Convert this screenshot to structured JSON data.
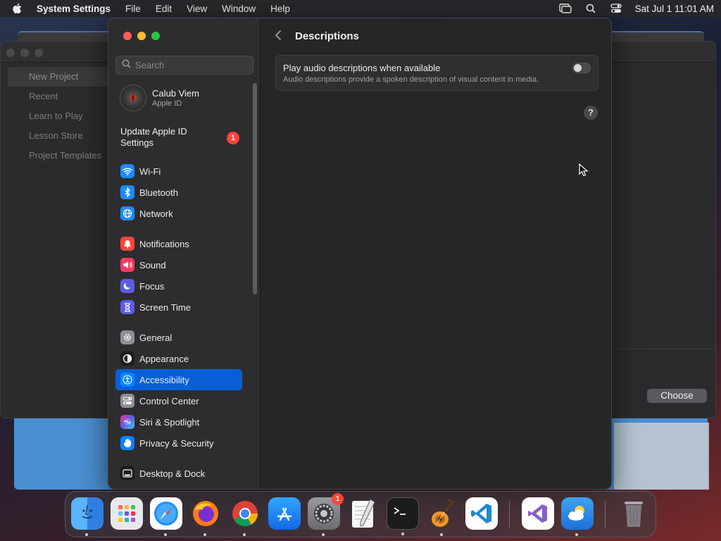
{
  "menubar": {
    "app_name": "System Settings",
    "menus": [
      "File",
      "Edit",
      "View",
      "Window",
      "Help"
    ],
    "clock": "Sat Jul 1  11:01 AM"
  },
  "background_window": {
    "sidebar_items": [
      "New Project",
      "Recent",
      "Learn to Play",
      "Lesson Store",
      "Project Templates"
    ],
    "choose_label": "Choose"
  },
  "search": {
    "placeholder": "Search",
    "value": ""
  },
  "profile": {
    "name": "Calub Viem",
    "subtitle": "Apple ID"
  },
  "update": {
    "label": "Update Apple ID Settings",
    "badge": "1"
  },
  "sidebar": {
    "group1": [
      {
        "label": "Wi-Fi",
        "icon": "wifi-icon",
        "color": "#1a8cff"
      },
      {
        "label": "Bluetooth",
        "icon": "bluetooth-icon",
        "color": "#1a8cff"
      },
      {
        "label": "Network",
        "icon": "globe-icon",
        "color": "#1a8cff"
      }
    ],
    "group2": [
      {
        "label": "Notifications",
        "icon": "bell-icon",
        "color": "#ff453a"
      },
      {
        "label": "Sound",
        "icon": "speaker-icon",
        "color": "#ff375f"
      },
      {
        "label": "Focus",
        "icon": "moon-icon",
        "color": "#5e5ce6"
      },
      {
        "label": "Screen Time",
        "icon": "hourglass-icon",
        "color": "#5e5ce6"
      }
    ],
    "group3": [
      {
        "label": "General",
        "icon": "gear-icon",
        "color": "#8e8e93"
      },
      {
        "label": "Appearance",
        "icon": "appearance-icon",
        "color": "#1c1c1e"
      },
      {
        "label": "Accessibility",
        "icon": "accessibility-icon",
        "color": "#0a84ff"
      },
      {
        "label": "Control Center",
        "icon": "control-center-icon",
        "color": "#8e8e93"
      },
      {
        "label": "Siri & Spotlight",
        "icon": "siri-icon",
        "color": "#bf5af2"
      },
      {
        "label": "Privacy & Security",
        "icon": "hand-icon",
        "color": "#0a84ff"
      }
    ],
    "group4": [
      {
        "label": "Desktop & Dock",
        "icon": "dock-icon",
        "color": "#1c1c1e"
      }
    ],
    "active": "Accessibility"
  },
  "content": {
    "title": "Descriptions",
    "setting": {
      "title": "Play audio descriptions when available",
      "subtitle": "Audio descriptions provide a spoken description of visual content in media.",
      "enabled": false
    },
    "help_label": "?"
  },
  "dock": {
    "apps": [
      {
        "name": "finder-icon",
        "color": "#2f8cf0",
        "running": true
      },
      {
        "name": "launchpad-icon",
        "color": "#e6e6ea",
        "running": false
      },
      {
        "name": "safari-icon",
        "color": "#1e90ff",
        "running": true
      },
      {
        "name": "firefox-icon",
        "color": "#ff7a18",
        "running": true
      },
      {
        "name": "chrome-icon",
        "color": "#ffffff",
        "running": true
      },
      {
        "name": "app-store-icon",
        "color": "#1e8cff",
        "running": false
      },
      {
        "name": "system-settings-icon",
        "color": "#8e8e93",
        "running": true,
        "badge": "1"
      },
      {
        "name": "textedit-icon",
        "color": "#f4f4f4",
        "running": false
      },
      {
        "name": "terminal-icon",
        "color": "#1c1c1e",
        "running": true
      },
      {
        "name": "garageband-icon",
        "color": "#e8a23a",
        "running": true
      },
      {
        "name": "vscode-icon",
        "color": "#ffffff",
        "running": false
      },
      {
        "name": "visual-studio-icon",
        "color": "#ffffff",
        "running": false
      },
      {
        "name": "weather-icon",
        "color": "#2a8de8",
        "running": true
      },
      {
        "name": "trash-icon",
        "color": "#6a6a70",
        "running": false
      }
    ]
  }
}
